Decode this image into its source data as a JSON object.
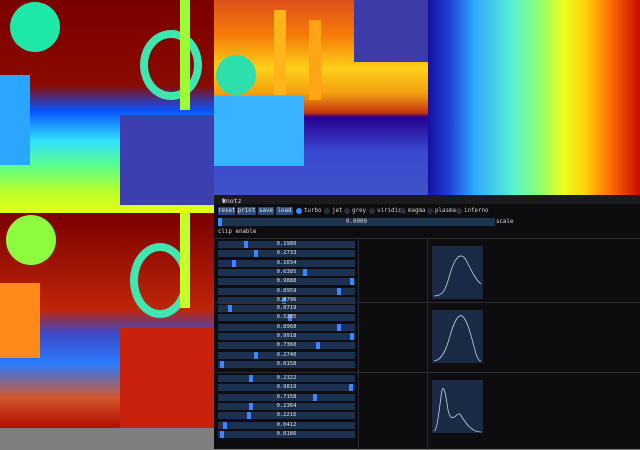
{
  "panel": {
    "title": "knotz",
    "buttons": [
      "reset",
      "print",
      "save",
      "load"
    ],
    "colormaps": [
      {
        "label": "turbo",
        "selected": true
      },
      {
        "label": "jet",
        "selected": false
      },
      {
        "label": "grey",
        "selected": false
      },
      {
        "label": "viridis",
        "selected": false
      },
      {
        "label": "magma",
        "selected": false
      },
      {
        "label": "plasma",
        "selected": false
      },
      {
        "label": "inferno",
        "selected": false
      }
    ],
    "scale": {
      "value": "0.0000",
      "label": "scale",
      "fraction": 0.0
    },
    "clip_label": "clip enable",
    "groups": [
      {
        "sliders": [
          {
            "value": "0.1980",
            "fraction": 0.198
          },
          {
            "value": "0.2733",
            "fraction": 0.2733
          },
          {
            "value": "0.1034",
            "fraction": 0.1034
          },
          {
            "value": "0.6385",
            "fraction": 0.6385
          },
          {
            "value": "0.9888",
            "fraction": 0.9888
          },
          {
            "value": "0.8959",
            "fraction": 0.8959
          },
          {
            "value": "0.4796",
            "fraction": 0.4796
          }
        ]
      },
      {
        "sliders": [
          {
            "value": "0.0719",
            "fraction": 0.0719
          },
          {
            "value": "0.5285",
            "fraction": 0.5285
          },
          {
            "value": "0.8968",
            "fraction": 0.8968
          },
          {
            "value": "0.9918",
            "fraction": 0.9918
          },
          {
            "value": "0.7360",
            "fraction": 0.736
          },
          {
            "value": "0.2740",
            "fraction": 0.274
          },
          {
            "value": "0.0158",
            "fraction": 0.0158
          }
        ]
      },
      {
        "sliders": [
          {
            "value": "0.2322",
            "fraction": 0.2322
          },
          {
            "value": "0.9819",
            "fraction": 0.9819
          },
          {
            "value": "0.7158",
            "fraction": 0.7158
          },
          {
            "value": "0.2364",
            "fraction": 0.2364
          },
          {
            "value": "0.2216",
            "fraction": 0.2216
          },
          {
            "value": "0.0412",
            "fraction": 0.0412
          },
          {
            "value": "0.0186",
            "fraction": 0.0186
          }
        ]
      }
    ]
  },
  "colors": {
    "accent": "#3d86ff",
    "slider_bg": "#1c3150",
    "button_bg": "#294a7a",
    "panel_bg": "#0d0d0f"
  }
}
